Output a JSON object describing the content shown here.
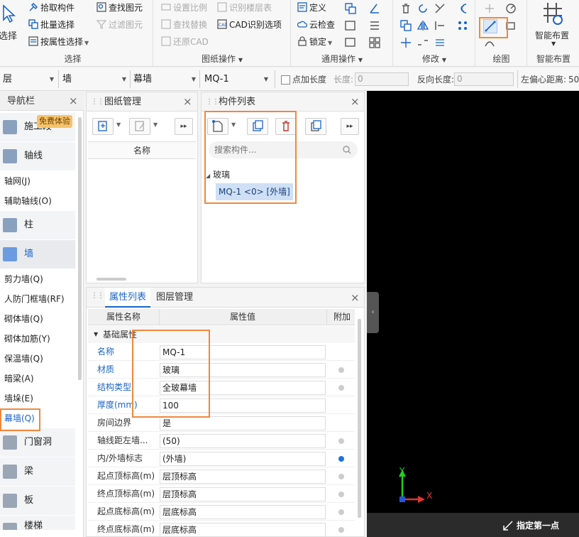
{
  "ribbon": {
    "select_group": {
      "title": "选择",
      "select_button": "选择",
      "pick_component": "拾取构件",
      "batch_select": "批量选择",
      "select_by_property": "按属性选择"
    },
    "drawing_ops_group": {
      "title": "图纸操作",
      "find_element": "查找图元",
      "filter_element": "过滤图元",
      "set_scale": "设置比例",
      "find_replace": "查找替换",
      "restore_cad": "还原CAD",
      "identify_floor_table": "识别楼层表",
      "cad_options": "CAD识别选项"
    },
    "common_ops_group": {
      "title": "通用操作",
      "define": "定义",
      "cloud_check": "云检查",
      "lock": "锁定"
    },
    "modify_group": {
      "title": "修改"
    },
    "draw_group": {
      "title": "绘图"
    },
    "smart_layout_group": {
      "title": "智能布置",
      "smart_layout": "智能布置"
    }
  },
  "toolbar2": {
    "floor_select": "层",
    "type_select": "墙",
    "subtype_select": "幕墙",
    "component_select": "MQ-1",
    "point_length_label": "点加长度",
    "length_label": "长度:",
    "length_value": "0",
    "reverse_length_label": "反向长度:",
    "reverse_length_value": "0",
    "left_offset_label": "左偏心距离:",
    "left_offset_value": "50"
  },
  "nav": {
    "title": "导航栏",
    "badge": "免费体验",
    "items": [
      {
        "label": "施工段",
        "kind": "cat"
      },
      {
        "label": "轴线",
        "kind": "cat"
      },
      {
        "label": "轴网(J)",
        "kind": "sub"
      },
      {
        "label": "辅助轴线(O)",
        "kind": "sub"
      },
      {
        "label": "柱",
        "kind": "cat"
      },
      {
        "label": "墙",
        "kind": "cat"
      },
      {
        "label": "剪力墙(Q)",
        "kind": "sub"
      },
      {
        "label": "人防门框墙(RF)",
        "kind": "sub"
      },
      {
        "label": "砌体墙(Q)",
        "kind": "sub"
      },
      {
        "label": "砌体加筋(Y)",
        "kind": "sub"
      },
      {
        "label": "保温墙(Q)",
        "kind": "sub"
      },
      {
        "label": "暗梁(A)",
        "kind": "sub"
      },
      {
        "label": "墙垛(E)",
        "kind": "sub"
      },
      {
        "label": "幕墙(Q)",
        "kind": "sub"
      },
      {
        "label": "门窗洞",
        "kind": "cat"
      },
      {
        "label": "梁",
        "kind": "cat"
      },
      {
        "label": "板",
        "kind": "cat"
      },
      {
        "label": "楼梯",
        "kind": "cat"
      }
    ]
  },
  "drawing_panel": {
    "title": "图纸管理",
    "name_header": "名称"
  },
  "component_panel": {
    "title": "构件列表",
    "search_placeholder": "搜索构件...",
    "group": "玻璃",
    "selected_item": "MQ-1 <0> [外墙]"
  },
  "property_panel": {
    "tab_properties": "属性列表",
    "tab_layers": "图层管理",
    "col_name": "属性名称",
    "col_value": "属性值",
    "col_extra": "附加",
    "section": "基础属性",
    "rows": [
      {
        "name": "名称",
        "value": "MQ-1"
      },
      {
        "name": "材质",
        "value": "玻璃"
      },
      {
        "name": "结构类型",
        "value": "全玻幕墙"
      },
      {
        "name": "厚度(mm)",
        "value": "100"
      },
      {
        "name": "房间边界",
        "value": "是"
      },
      {
        "name": "轴线距左墙...",
        "value": "(50)"
      },
      {
        "name": "内/外墙标志",
        "value": "(外墙)"
      },
      {
        "name": "起点顶标高(m)",
        "value": "层顶标高"
      },
      {
        "name": "终点顶标高(m)",
        "value": "层顶标高"
      },
      {
        "name": "起点底标高(m)",
        "value": "层底标高"
      },
      {
        "name": "终点底标高(m)",
        "value": "层底标高"
      }
    ]
  },
  "canvas": {
    "status_text": "指定第一点",
    "axis_x": "X",
    "axis_y": "Y"
  },
  "colors": {
    "highlight": "#f0883e",
    "accent_blue": "#1a64c8",
    "canvas_bg": "#000000"
  }
}
